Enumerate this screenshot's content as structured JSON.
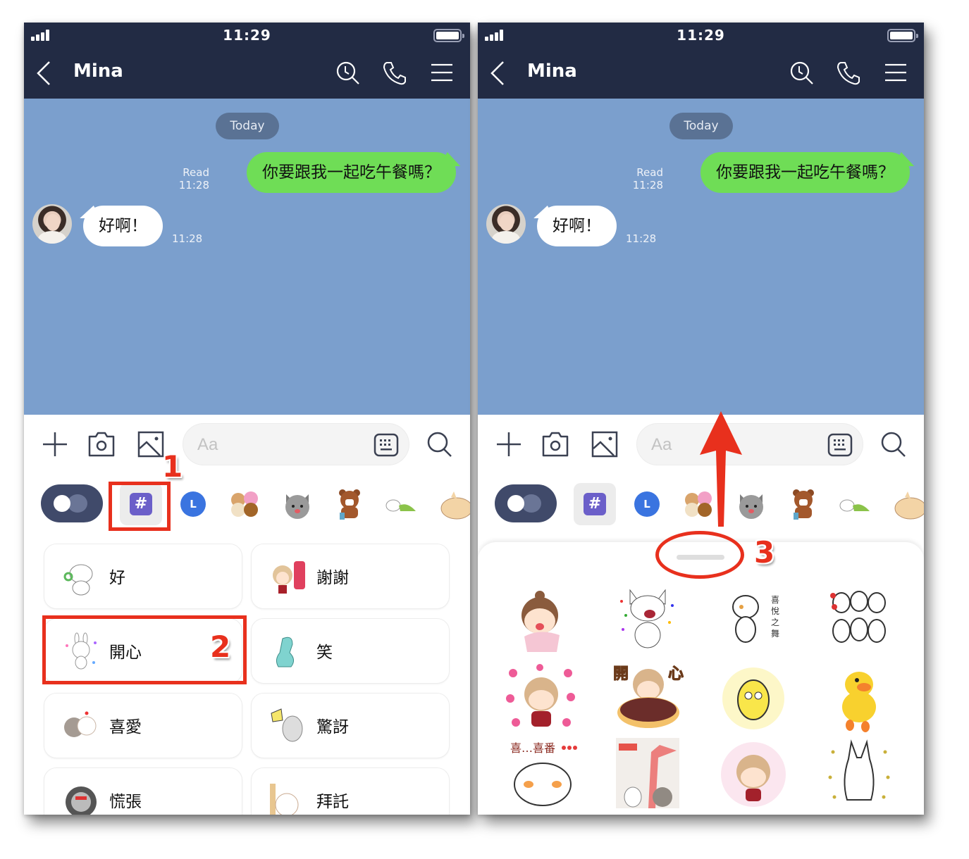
{
  "screens": [
    {
      "id": "left",
      "status_time": "11:29",
      "header": {
        "title": "Mina",
        "icons": [
          "back-chevron-icon",
          "search-history-icon",
          "phone-call-icon",
          "menu-icon"
        ]
      },
      "chat": {
        "date_pill": "Today",
        "messages": [
          {
            "side": "out",
            "text": "你要跟我一起吃午餐嗎？",
            "read_label": "Read",
            "time": "11:28"
          },
          {
            "side": "in",
            "text": "好啊！",
            "time": "11:28",
            "sender": "Mina"
          }
        ]
      },
      "input": {
        "placeholder": "Aa"
      },
      "tabs": {
        "hash_label": "#",
        "l_label": "L"
      },
      "keywords": [
        "好",
        "謝謝",
        "開心",
        "笑",
        "喜愛",
        "驚訝",
        "慌張",
        "拜託"
      ]
    },
    {
      "id": "right",
      "status_time": "11:29",
      "header": {
        "title": "Mina"
      },
      "chat": {
        "date_pill": "Today",
        "messages": [
          {
            "side": "out",
            "text": "你要跟我一起吃午餐嗎？",
            "read_label": "Read",
            "time": "11:28"
          },
          {
            "side": "in",
            "text": "好啊！",
            "time": "11:28"
          }
        ]
      },
      "input": {
        "placeholder": "Aa"
      },
      "tabs": {
        "hash_label": "#",
        "l_label": "L"
      },
      "stickers": [
        "girl-bun-cheer",
        "bulldog-confetti",
        "bear-喜悅之舞",
        "rabbits-dance",
        "girl-hearts",
        "girl-開心-donut",
        "chick-sparkle",
        "sally-duck",
        "hamster-喜…喜番",
        "tube-man-dance",
        "girl-pink-dots",
        "rabbit-sparkles"
      ],
      "sticker_texts": {
        "bear": "喜悅之舞",
        "donut": "開心",
        "hamster": "喜…喜番"
      }
    }
  ],
  "annotations": [
    {
      "number": "1",
      "target": "hashtag-tab"
    },
    {
      "number": "2",
      "target": "keyword-開心"
    },
    {
      "number": "3",
      "target": "sheet-drag-handle"
    }
  ],
  "colors": {
    "header": "#222b44",
    "chat_bg": "#7b9fcd",
    "out_bubble": "#6fdd56",
    "hash_tab": "#6b5fc9",
    "annotation": "#e8301d"
  }
}
